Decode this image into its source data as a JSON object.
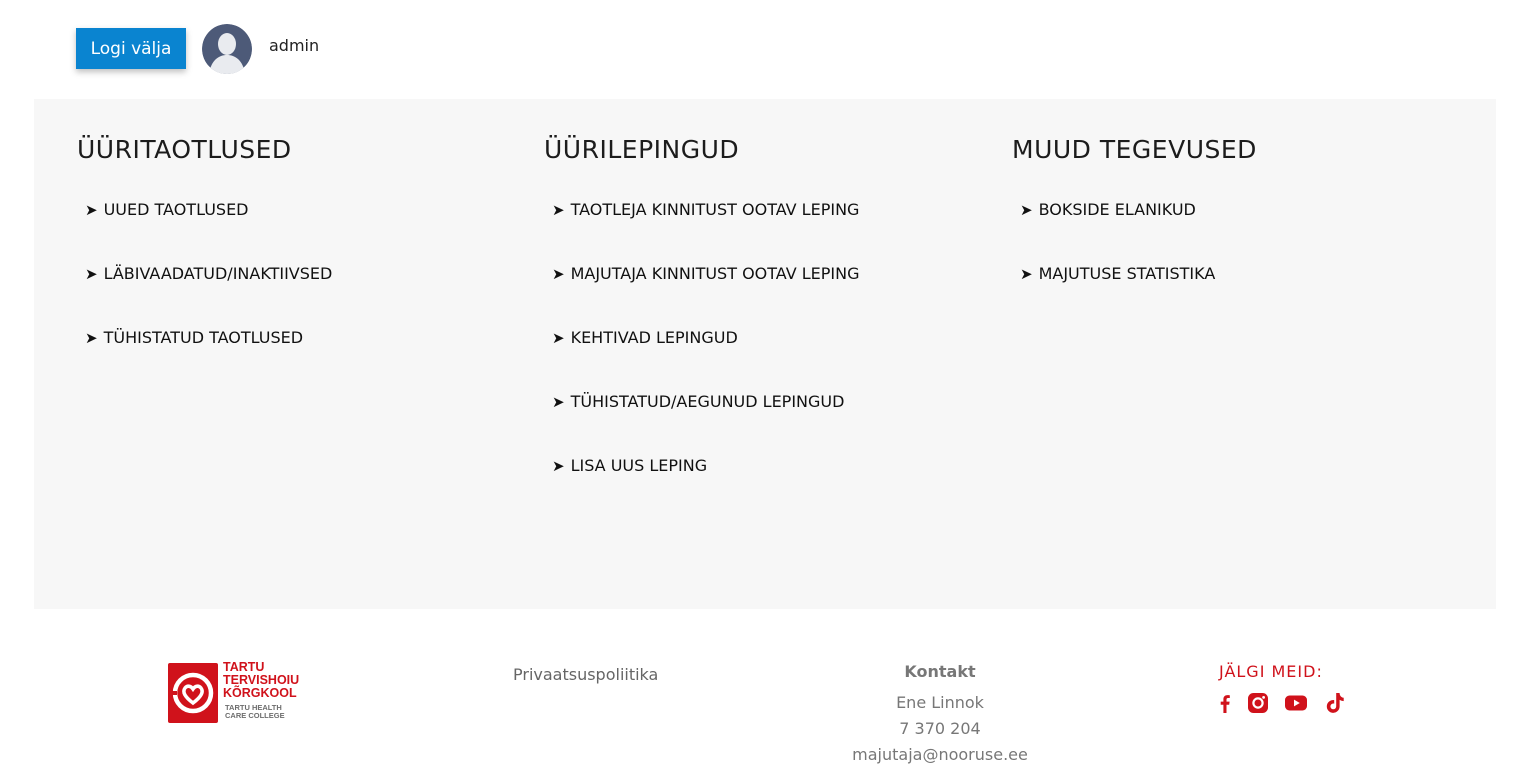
{
  "header": {
    "logout_label": "Logi välja",
    "username": "admin"
  },
  "sections": [
    {
      "title": "ÜÜRITAOTLUSED",
      "items": [
        "UUED TAOTLUSED",
        "LÄBIVAADATUD/INAKTIIVSED",
        "TÜHISTATUD TAOTLUSED"
      ]
    },
    {
      "title": "ÜÜRILEPINGUD",
      "items": [
        "TAOTLEJA KINNITUST OOTAV LEPING",
        "MAJUTAJA KINNITUST OOTAV LEPING",
        "KEHTIVAD LEPINGUD",
        "TÜHISTATUD/AEGUNUD LEPINGUD",
        "LISA UUS LEPING"
      ]
    },
    {
      "title": "MUUD TEGEVUSED",
      "items": [
        "BOKSIDE ELANIKUD",
        "MAJUTUSE STATISTIKA"
      ]
    }
  ],
  "item_arrow": "➤",
  "footer": {
    "logo_lines": [
      "TARTU",
      "TERVISHOIU",
      "KÕRGKOOL"
    ],
    "logo_sub_lines": [
      "TARTU HEALTH",
      "CARE COLLEGE"
    ],
    "privacy_label": "Privaatsuspoliitika",
    "contact_title": "Kontakt",
    "contact_name": "Ene Linnok",
    "contact_phone": "7 370 204",
    "contact_email": "majutaja@nooruse.ee",
    "follow_label": "JÄLGI MEID:",
    "social_icons": [
      "facebook-icon",
      "instagram-icon",
      "youtube-icon",
      "tiktok-icon"
    ]
  },
  "colors": {
    "accent_blue": "#0a84d0",
    "brand_red": "#d0121b",
    "panel_bg": "#f7f7f7"
  }
}
